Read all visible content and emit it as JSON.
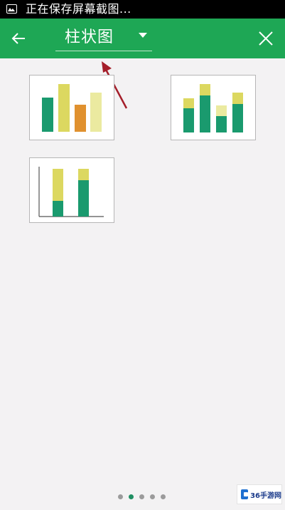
{
  "status_bar": {
    "text": "正在保存屏幕截图...",
    "icon": "image-icon"
  },
  "header": {
    "title": "柱状图",
    "back_icon": "back-arrow-icon",
    "dropdown_icon": "dropdown-caret-icon",
    "close_icon": "close-icon"
  },
  "chart_types": [
    {
      "name": "clustered-column",
      "icon": "clustered-column-chart-icon"
    },
    {
      "name": "stacked-column",
      "icon": "stacked-column-chart-icon"
    },
    {
      "name": "stacked-column-axis",
      "icon": "stacked-column-with-axis-chart-icon"
    }
  ],
  "pager": {
    "pages": 5,
    "active": 2
  },
  "watermark": {
    "text": "36手游网"
  },
  "colors": {
    "header": "#1ea755",
    "teal": "#1a9a6e",
    "yellow": "#dcd860",
    "orange": "#e0912f",
    "light_yellow": "#ebeaa0"
  }
}
